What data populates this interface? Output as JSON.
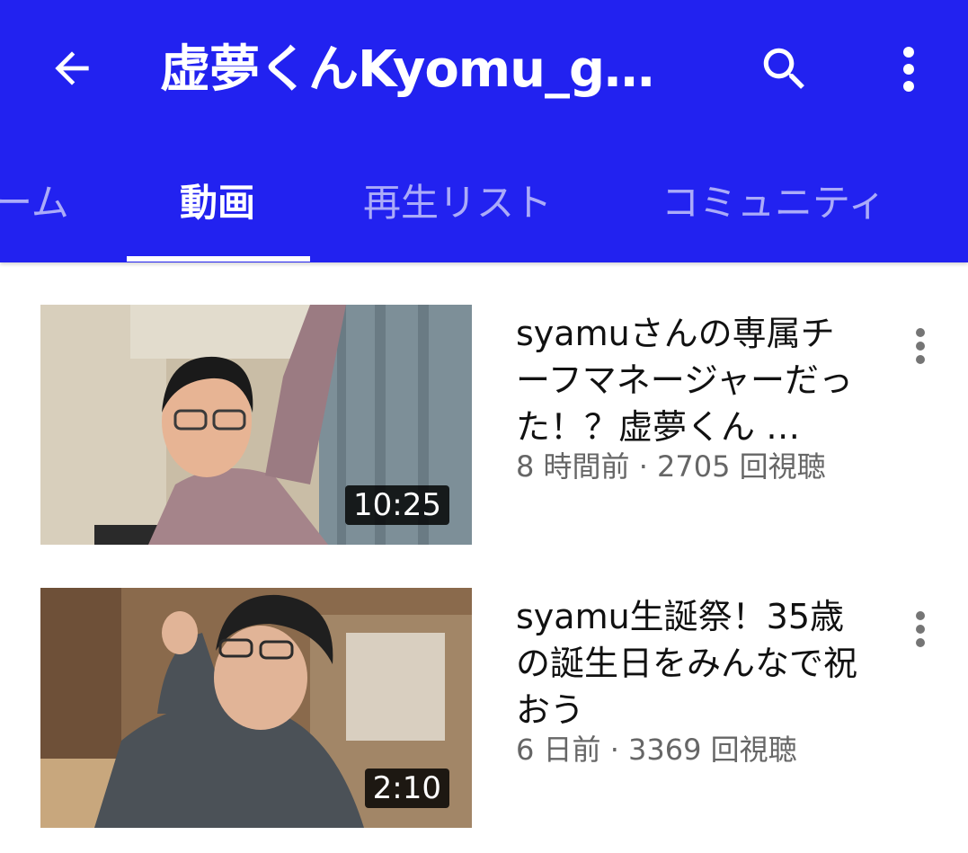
{
  "header": {
    "title": "虚夢くんKyomu_gamer",
    "back_icon": "arrow-back-icon",
    "search_icon": "search-icon",
    "more_icon": "more-vertical-icon",
    "background_color": "#2222f0"
  },
  "tabs": [
    {
      "label": "ーム",
      "active": false
    },
    {
      "label": "動画",
      "active": true
    },
    {
      "label": "再生リスト",
      "active": false
    },
    {
      "label": "コミュニティ",
      "active": false
    }
  ],
  "videos": [
    {
      "title": "syamuさんの専属チーフマネージャーだった！？虚夢くん …",
      "duration": "10:25",
      "meta": "8 時間前 · 2705 回視聴",
      "menu_icon": "more-vertical-icon"
    },
    {
      "title": "syamu生誕祭！35歳の誕生日をみんなで祝おう",
      "duration": "2:10",
      "meta": "6 日前 · 3369 回視聴",
      "menu_icon": "more-vertical-icon"
    }
  ]
}
